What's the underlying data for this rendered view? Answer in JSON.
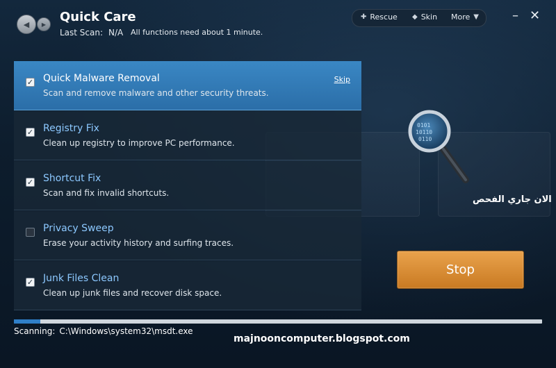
{
  "header": {
    "title": "Quick Care",
    "last_scan_label": "Last Scan:",
    "last_scan_value": "N/A",
    "hint": "All functions need about 1 minute."
  },
  "menu": {
    "rescue": "Rescue",
    "skin": "Skin",
    "more": "More"
  },
  "tasks": [
    {
      "title": "Quick Malware Removal",
      "desc": "Scan and remove malware and other security threats.",
      "checked": true,
      "active": true,
      "action": "Skip"
    },
    {
      "title": "Registry Fix",
      "desc": "Clean up registry to improve PC performance.",
      "checked": true
    },
    {
      "title": "Shortcut Fix",
      "desc": "Scan and fix invalid shortcuts.",
      "checked": true
    },
    {
      "title": "Privacy Sweep",
      "desc": "Erase your activity history and surfing traces.",
      "checked": false
    },
    {
      "title": "Junk Files Clean",
      "desc": "Clean up junk files and recover disk space.",
      "checked": true
    }
  ],
  "status": {
    "arabic": "الان جاري الفحص",
    "stop_label": "Stop",
    "progress": 0.05,
    "scanning_label": "Scanning:",
    "scanning_path": "C:\\Windows\\system32\\msdt.exe"
  },
  "watermark": "majnooncomputer.blogspot.com",
  "colors": {
    "accent": "#2f7fc8",
    "stop": "#d98a32",
    "link": "#8cc8ff"
  }
}
